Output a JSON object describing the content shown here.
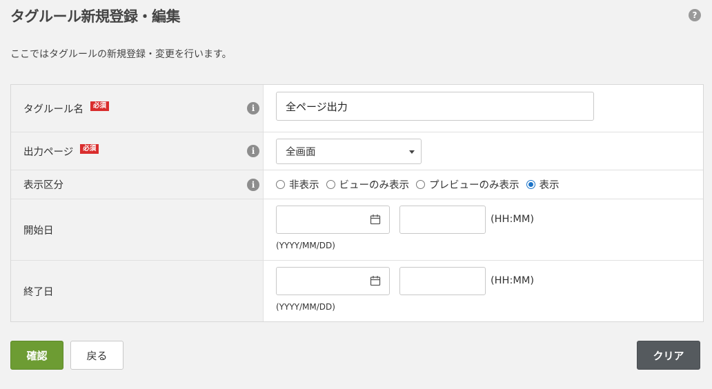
{
  "page": {
    "title": "タグルール新規登録・編集",
    "help_icon": "?",
    "description": "ここではタグルールの新規登録・変更を行います。"
  },
  "form": {
    "info_icon": "i",
    "required_label": "必須",
    "rule_name": {
      "label": "タグルール名",
      "value": "全ページ出力"
    },
    "output_page": {
      "label": "出力ページ",
      "selected": "全画面"
    },
    "display_type": {
      "label": "表示区分",
      "options": [
        "非表示",
        "ビューのみ表示",
        "プレビューのみ表示",
        "表示"
      ],
      "selected": "表示"
    },
    "start_date": {
      "label": "開始日",
      "date_value": "",
      "time_value": "",
      "time_hint": "(HH:MM)",
      "date_hint": "(YYYY/MM/DD)"
    },
    "end_date": {
      "label": "終了日",
      "date_value": "",
      "time_value": "",
      "time_hint": "(HH:MM)",
      "date_hint": "(YYYY/MM/DD)"
    }
  },
  "buttons": {
    "confirm": "確認",
    "back": "戻る",
    "clear": "クリア"
  },
  "colors": {
    "confirm_bg": "#6d9c33",
    "clear_bg": "#555a5e",
    "required_bg": "#d92d2d",
    "radio_checked": "#1a73c8"
  }
}
